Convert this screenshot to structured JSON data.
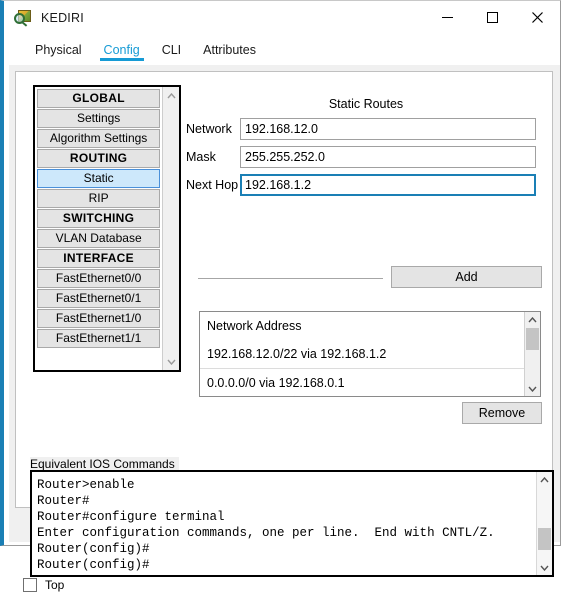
{
  "window": {
    "title": "KEDIRI",
    "icon": "packet-tracer-inspect-icon",
    "accent_color": "#1a7fb5",
    "controls": {
      "minimize": "minimize-icon",
      "maximize": "maximize-icon",
      "close": "close-icon"
    }
  },
  "tabs": [
    {
      "label": "Physical",
      "active": false
    },
    {
      "label": "Config",
      "active": true
    },
    {
      "label": "CLI",
      "active": false
    },
    {
      "label": "Attributes",
      "active": false
    }
  ],
  "tab_active_color": "#169bd5",
  "sidebar": {
    "items": [
      {
        "label": "GLOBAL",
        "type": "header"
      },
      {
        "label": "Settings",
        "type": "item"
      },
      {
        "label": "Algorithm Settings",
        "type": "item"
      },
      {
        "label": "ROUTING",
        "type": "header"
      },
      {
        "label": "Static",
        "type": "item",
        "selected": true
      },
      {
        "label": "RIP",
        "type": "item"
      },
      {
        "label": "SWITCHING",
        "type": "header"
      },
      {
        "label": "VLAN Database",
        "type": "item"
      },
      {
        "label": "INTERFACE",
        "type": "header"
      },
      {
        "label": "FastEthernet0/0",
        "type": "item"
      },
      {
        "label": "FastEthernet0/1",
        "type": "item"
      },
      {
        "label": "FastEthernet1/0",
        "type": "item"
      },
      {
        "label": "FastEthernet1/1",
        "type": "item"
      }
    ],
    "selected_color": "#cde8fb"
  },
  "static_routes": {
    "title": "Static Routes",
    "fields": [
      {
        "label": "Network",
        "value": "192.168.12.0",
        "focused": false
      },
      {
        "label": "Mask",
        "value": "255.255.252.0",
        "focused": false
      },
      {
        "label": "Next Hop",
        "value": "192.168.1.2",
        "focused": true
      }
    ],
    "add_label": "Add",
    "remove_label": "Remove",
    "list": {
      "header": "Network Address",
      "rows": [
        "192.168.12.0/22 via 192.168.1.2",
        "0.0.0.0/0 via 192.168.0.1"
      ]
    }
  },
  "ios": {
    "label": "Equivalent IOS Commands",
    "lines": "Router>enable\nRouter#\nRouter#configure terminal\nEnter configuration commands, one per line.  End with CNTL/Z.\nRouter(config)#\nRouter(config)#"
  },
  "bottom": {
    "top_checkbox_label": "Top",
    "top_checkbox_checked": false
  }
}
